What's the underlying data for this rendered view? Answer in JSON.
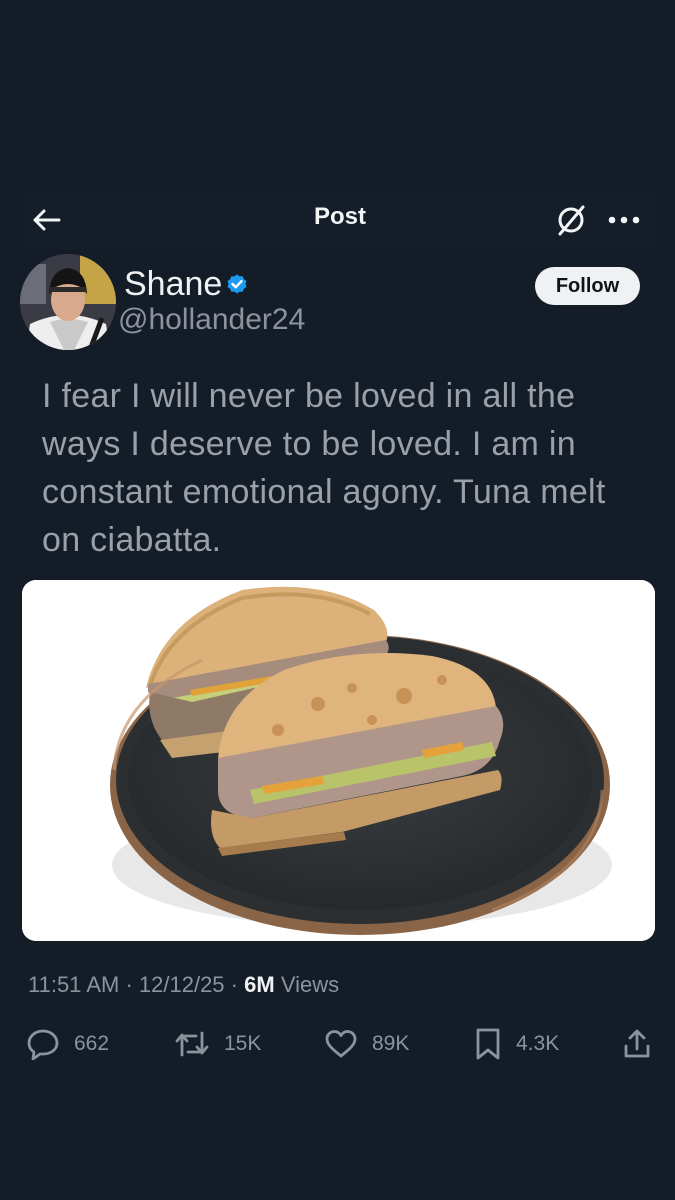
{
  "header": {
    "title": "Post",
    "icons": [
      "back-arrow-icon",
      "grok-icon",
      "more-icon"
    ]
  },
  "author": {
    "display_name": "Shane",
    "handle": "@hollander24",
    "verified": true,
    "follow_label": "Follow"
  },
  "tweet": {
    "text": "I fear I will never be loved in all the ways I deserve to be loved. I am in constant emotional agony. Tuna melt on ciabatta."
  },
  "meta": {
    "time": "11:51 AM",
    "date": "12/12/25",
    "views_count": "6M",
    "views_label": "Views",
    "separator": "·"
  },
  "actions": {
    "replies": "662",
    "reposts": "15K",
    "likes": "89K",
    "bookmarks": "4.3K"
  },
  "colors": {
    "background": "#141c28",
    "text_primary": "#e7e9ea",
    "text_secondary": "#8b939c",
    "verified_blue": "#1d9bf0"
  }
}
